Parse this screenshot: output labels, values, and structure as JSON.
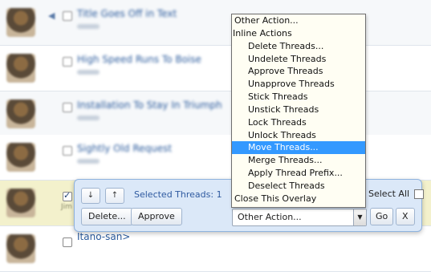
{
  "threads": [
    {
      "title": "Title Goes Off in Text",
      "checked": false
    },
    {
      "title": "High Speed Runs To Boise",
      "checked": false
    },
    {
      "title": "Installation To Stay In Triumph",
      "checked": false
    },
    {
      "title": "Sightly Old Request",
      "checked": false
    },
    {
      "title": "",
      "checked": true,
      "author": "Jim"
    },
    {
      "title": "Itano-san>",
      "checked": false
    }
  ],
  "overlay": {
    "up_label": "↓",
    "down_label": "↑",
    "selected_label": "Selected Threads: 1",
    "select_all_label": "Select All",
    "delete_label": "Delete...",
    "approve_label": "Approve",
    "action_value": "Other Action...",
    "go_label": "Go",
    "close_label": "X"
  },
  "menu": {
    "top": "Other Action...",
    "group": "Inline Actions",
    "options": [
      "Delete Threads...",
      "Undelete Threads",
      "Approve Threads",
      "Unapprove Threads",
      "Stick Threads",
      "Unstick Threads",
      "Lock Threads",
      "Unlock Threads",
      "Move Threads...",
      "Merge Threads...",
      "Apply Thread Prefix...",
      "Deselect Threads"
    ],
    "highlighted": "Move Threads...",
    "close": "Close This Overlay"
  },
  "colors": {
    "highlight": "#3399ff",
    "menu_bg": "#fffef3",
    "overlay_bg": "#dbe8f8",
    "link": "#2a5a9c"
  }
}
